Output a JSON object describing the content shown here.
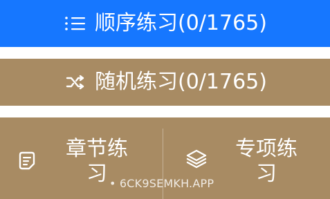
{
  "practice_sequential": {
    "label": "顺序练习(0/1765)",
    "icon": "list-icon",
    "color": "#1677ff"
  },
  "practice_random": {
    "label": "随机练习(0/1765)",
    "icon": "shuffle-icon",
    "color": "#a88b63"
  },
  "chapter_practice": {
    "label": "章节练习",
    "icon": "notebook-icon"
  },
  "topic_practice": {
    "label": "专项练习",
    "icon": "layers-icon"
  },
  "watermark": {
    "text": "• 6CK9SEMKH.APP"
  }
}
